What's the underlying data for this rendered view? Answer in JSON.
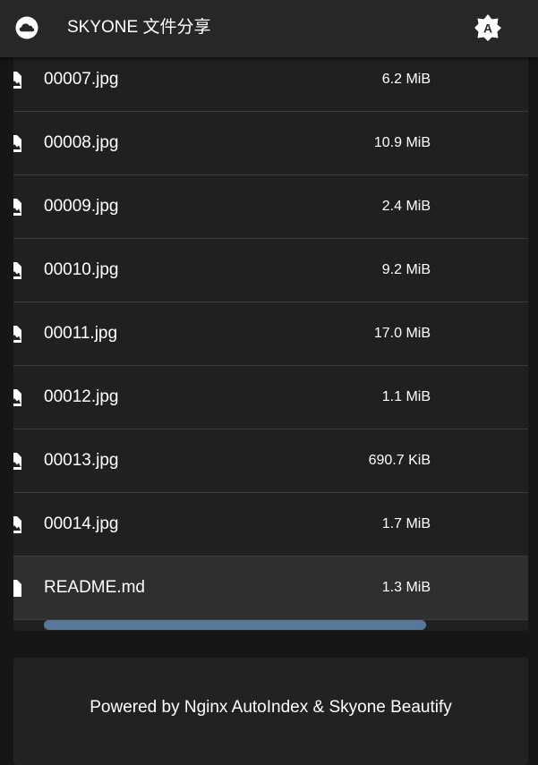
{
  "header": {
    "title": "SKYONE 文件分享",
    "logo_icon": "cloud-icon",
    "theme_icon": "brightness-auto-icon",
    "theme_letter": "A",
    "background": "#272727"
  },
  "file_list": {
    "rows": [
      {
        "name": "00007.jpg",
        "size": "6.2 MiB",
        "icon": "image-file-icon"
      },
      {
        "name": "00008.jpg",
        "size": "10.9 MiB",
        "icon": "image-file-icon"
      },
      {
        "name": "00009.jpg",
        "size": "2.4 MiB",
        "icon": "image-file-icon"
      },
      {
        "name": "00010.jpg",
        "size": "9.2 MiB",
        "icon": "image-file-icon"
      },
      {
        "name": "00011.jpg",
        "size": "17.0 MiB",
        "icon": "image-file-icon"
      },
      {
        "name": "00012.jpg",
        "size": "1.1 MiB",
        "icon": "image-file-icon"
      },
      {
        "name": "00013.jpg",
        "size": "690.7 KiB",
        "icon": "image-file-icon"
      },
      {
        "name": "00014.jpg",
        "size": "1.7 MiB",
        "icon": "image-file-icon"
      },
      {
        "name": "README.md",
        "size": "1.3 MiB",
        "icon": "document-file-icon"
      }
    ],
    "selected_row": "README.md",
    "scrollbar_color": "#58789a"
  },
  "footer": {
    "text": "Powered by Nginx AutoIndex & Skyone Beautify"
  }
}
